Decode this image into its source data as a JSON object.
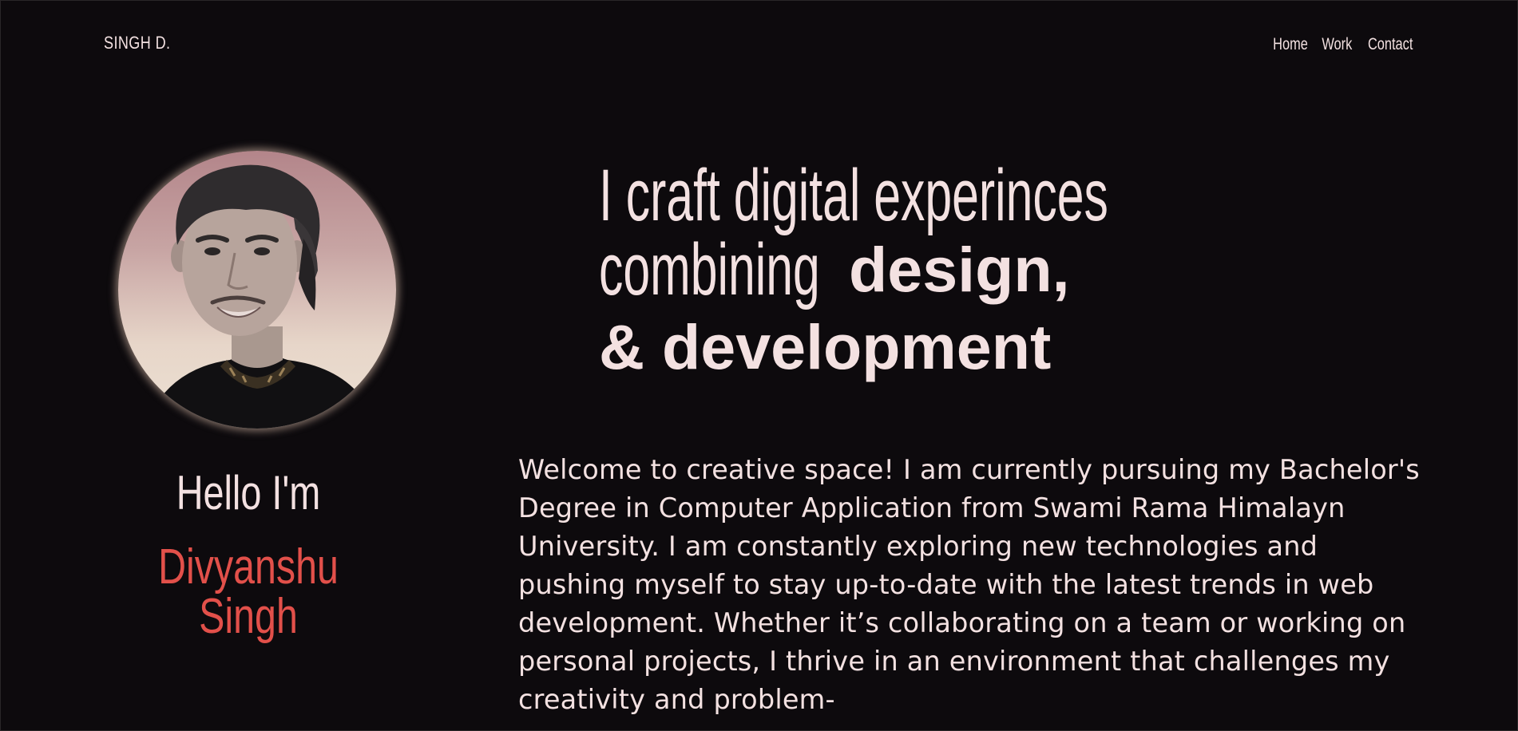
{
  "header": {
    "brand": "SINGH D.",
    "nav": {
      "home": "Home",
      "work": "Work",
      "contact": "Contact"
    }
  },
  "profile": {
    "greeting": "Hello I'm",
    "name": "Divyanshu Singh"
  },
  "hero": {
    "line1": "I craft digital experinces",
    "line2_light": "combining",
    "line2_bold": "design,",
    "line3_bold": "& development"
  },
  "intro": {
    "text": "Welcome to creative space! I am currently pursuing my Bachelor's Degree in Computer Application from Swami Rama Himalayn University. I am constantly exploring new technologies and pushing myself to stay up-to-date with the latest trends in web development. Whether it’s collaborating on a team or working on personal projects, I thrive in an environment that challenges my creativity and problem-"
  },
  "colors": {
    "background": "#0d0a0d",
    "text": "#f3e1e1",
    "accent": "#e2504a"
  }
}
